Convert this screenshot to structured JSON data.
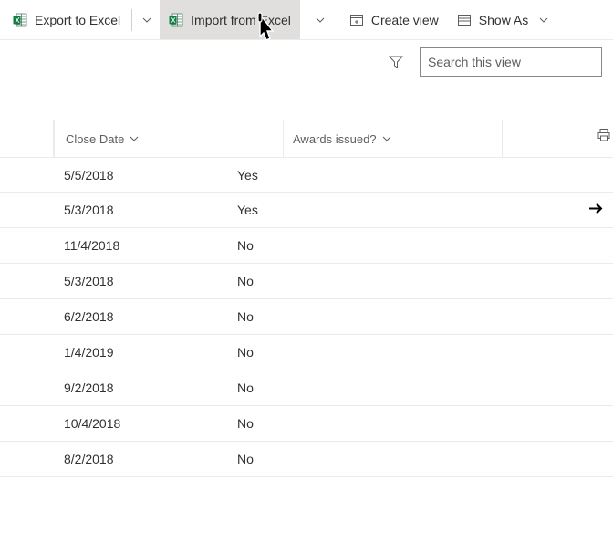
{
  "toolbar": {
    "export_label": "Export to Excel",
    "import_label": "Import from Excel",
    "create_view_label": "Create view",
    "show_as_label": "Show As"
  },
  "search": {
    "placeholder": "Search this view"
  },
  "columns": {
    "close_date": "Close Date",
    "awards_issued": "Awards issued?"
  },
  "rows": [
    {
      "close_date": "5/5/2018",
      "awards": "Yes",
      "arrow": false
    },
    {
      "close_date": "5/3/2018",
      "awards": "Yes",
      "arrow": true
    },
    {
      "close_date": "11/4/2018",
      "awards": "No",
      "arrow": false
    },
    {
      "close_date": "5/3/2018",
      "awards": "No",
      "arrow": false
    },
    {
      "close_date": "6/2/2018",
      "awards": "No",
      "arrow": false
    },
    {
      "close_date": "1/4/2019",
      "awards": "No",
      "arrow": false
    },
    {
      "close_date": "9/2/2018",
      "awards": "No",
      "arrow": false
    },
    {
      "close_date": "10/4/2018",
      "awards": "No",
      "arrow": false
    },
    {
      "close_date": "8/2/2018",
      "awards": "No",
      "arrow": false
    }
  ]
}
